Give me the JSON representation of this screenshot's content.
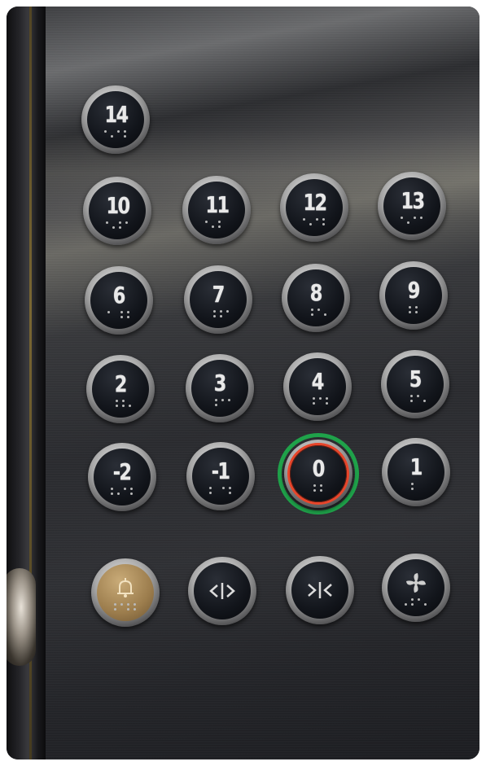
{
  "panel": {
    "buttons": [
      {
        "label": "14"
      },
      {
        "label": "10"
      },
      {
        "label": "11"
      },
      {
        "label": "12"
      },
      {
        "label": "13"
      },
      {
        "label": "6"
      },
      {
        "label": "7"
      },
      {
        "label": "8"
      },
      {
        "label": "9"
      },
      {
        "label": "2"
      },
      {
        "label": "3"
      },
      {
        "label": "4"
      },
      {
        "label": "5"
      },
      {
        "label": "-2"
      },
      {
        "label": "-1"
      },
      {
        "label": "0"
      },
      {
        "label": "1"
      }
    ],
    "function_buttons": [
      {
        "icon": "bell-icon"
      },
      {
        "icon": "door-open-icon"
      },
      {
        "icon": "door-close-icon"
      },
      {
        "icon": "fan-icon"
      }
    ],
    "active_floor": "0",
    "colors": {
      "active_ring_inner": "#e8452a",
      "active_ring_outer": "#1fa24a",
      "alarm_button": "#b08e5a"
    }
  }
}
